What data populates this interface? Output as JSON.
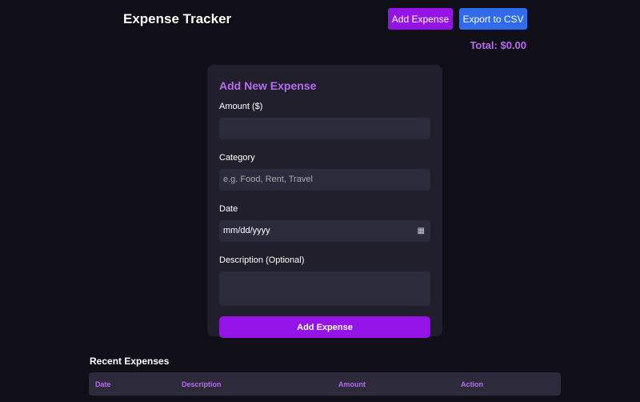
{
  "header": {
    "title": "Expense Tracker",
    "add_label": "Add Expense",
    "export_label": "Export to CSV",
    "total": "Total: $0.00"
  },
  "form": {
    "title": "Add New Expense",
    "amount_label": "Amount ($)",
    "amount_value": "",
    "category_label": "Category",
    "category_placeholder": "e.g. Food, Rent, Travel",
    "date_label": "Date",
    "date_placeholder": "mm/dd/yyyy",
    "description_label": "Description (Optional)",
    "description_value": "",
    "submit_label": "Add Expense"
  },
  "table": {
    "title": "Recent Expenses",
    "columns": [
      "Date",
      "Description",
      "Amount",
      "Action"
    ]
  },
  "colors": {
    "purple": "#9414e8",
    "blue": "#2f6bea",
    "accent": "#b76cf0"
  }
}
